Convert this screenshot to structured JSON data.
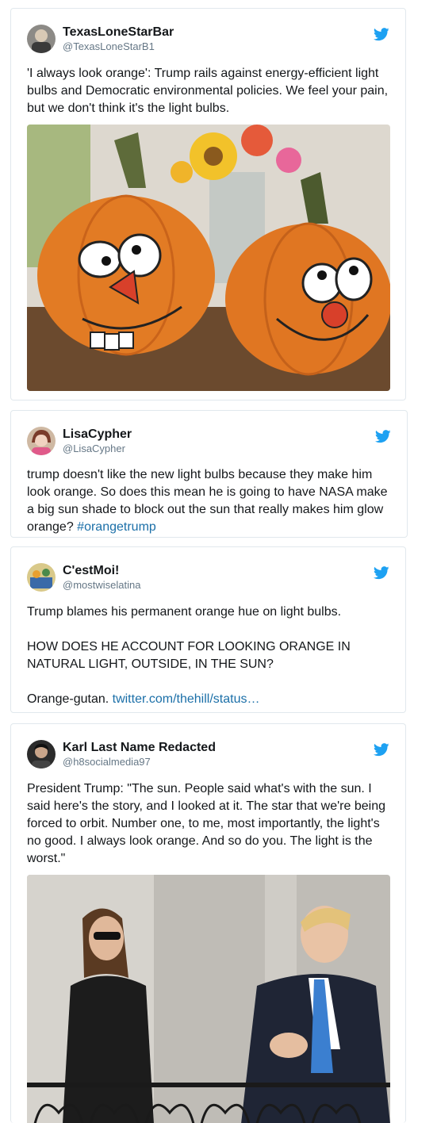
{
  "tweets": [
    {
      "name": "TexasLoneStarBar",
      "handle": "@TexasLoneStarB1",
      "text": "'I always look orange': Trump rails against energy-efficient light bulbs and Democratic environmental policies. We feel your pain, but we don't think it's the light bulbs.",
      "icon": "twitter-bird-icon"
    },
    {
      "name": "LisaCypher",
      "handle": "@LisaCypher",
      "text": "trump doesn't like the new light bulbs because they make him look orange.  So does this mean he is going to have NASA make a big sun shade to block out the sun that really makes him glow orange? ",
      "hashtag": "#orangetrump",
      "icon": "twitter-bird-icon"
    },
    {
      "name": "C'estMoi!",
      "handle": "@mostwiselatina",
      "text": "Trump blames his permanent orange hue on light bulbs.\n\nHOW DOES HE ACCOUNT FOR LOOKING ORANGE IN NATURAL LIGHT, OUTSIDE, IN THE SUN?\n\nOrange-gutan. ",
      "link": "twitter.com/thehill/status…",
      "icon": "twitter-bird-icon"
    },
    {
      "name": "Karl Last Name Redacted",
      "handle": "@h8socialmedia97",
      "text": "President Trump: \"The sun. People said what's with the sun. I said here's the story, and I looked at it. The star that we're being forced to orbit. Number one, to me, most importantly, the light's no good. I always look orange. And so do you. The light is the worst.\"",
      "icon": "twitter-bird-icon"
    }
  ],
  "colors": {
    "bird": "#1da1f2",
    "link": "#1b6fa8",
    "handle": "#657786",
    "border": "#e1e8ed"
  }
}
